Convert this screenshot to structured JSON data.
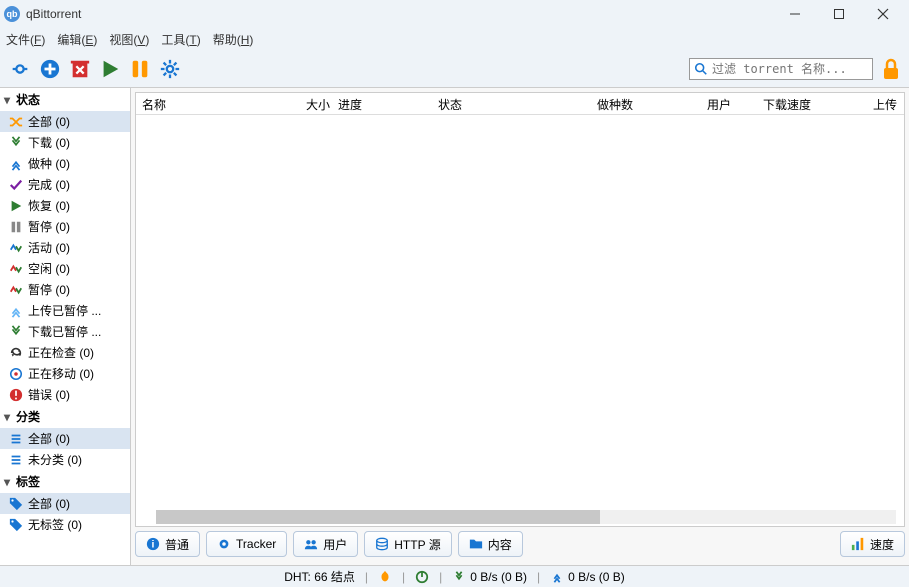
{
  "window": {
    "title": "qBittorrent"
  },
  "menu": {
    "file": "文件(F)",
    "edit": "编辑(E)",
    "view": "视图(V)",
    "tools": "工具(T)",
    "help": "帮助(H)"
  },
  "filter": {
    "placeholder": "过滤 torrent 名称..."
  },
  "sidebar": {
    "status_header": "状态",
    "status": [
      {
        "label": "全部 (0)",
        "icon": "shuffle",
        "sel": true
      },
      {
        "label": "下载 (0)",
        "icon": "down-green"
      },
      {
        "label": "做种 (0)",
        "icon": "up-blue"
      },
      {
        "label": "完成 (0)",
        "icon": "check-purple"
      },
      {
        "label": "恢复 (0)",
        "icon": "play-green"
      },
      {
        "label": "暂停 (0)",
        "icon": "pause-gray"
      },
      {
        "label": "活动 (0)",
        "icon": "updown-active"
      },
      {
        "label": "空闲 (0)",
        "icon": "updown-idle"
      },
      {
        "label": "暂停 (0)",
        "icon": "updown-idle"
      },
      {
        "label": "上传已暂停 ...",
        "icon": "up-lblue"
      },
      {
        "label": "下载已暂停 ...",
        "icon": "down-green"
      },
      {
        "label": "正在检查 (0)",
        "icon": "refresh"
      },
      {
        "label": "正在移动 (0)",
        "icon": "move"
      },
      {
        "label": "错误 (0)",
        "icon": "error"
      }
    ],
    "categories_header": "分类",
    "categories": [
      {
        "label": "全部 (0)",
        "sel": true
      },
      {
        "label": "未分类 (0)"
      }
    ],
    "tags_header": "标签",
    "tags": [
      {
        "label": "全部 (0)",
        "sel": true
      },
      {
        "label": "无标签 (0)"
      }
    ]
  },
  "columns": {
    "name": "名称",
    "size": "大小",
    "progress": "进度",
    "status": "状态",
    "seeds": "做种数",
    "peers": "用户",
    "dlspeed": "下载速度",
    "upspeed": "上传"
  },
  "detail_tabs": {
    "general": "普通",
    "tracker": "Tracker",
    "peers": "用户",
    "http": "HTTP 源",
    "content": "内容",
    "speed": "速度"
  },
  "statusbar": {
    "dht": "DHT: 66 结点",
    "down": "0 B/s (0 B)",
    "up": "0 B/s (0 B)"
  }
}
